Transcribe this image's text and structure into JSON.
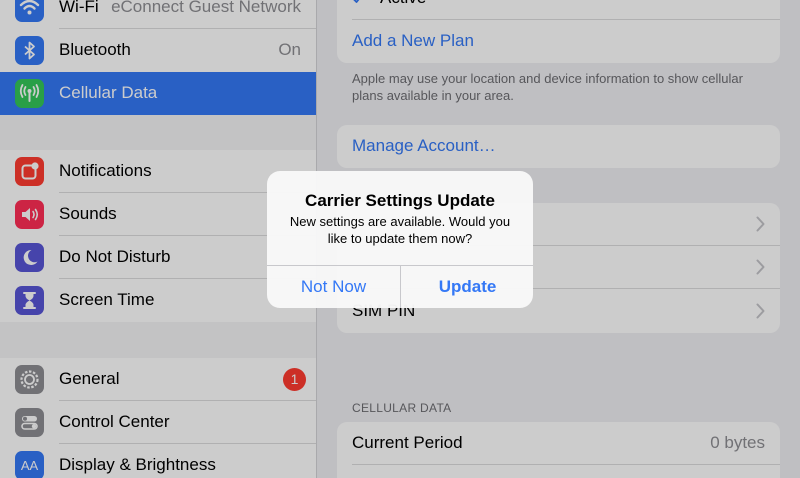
{
  "sidebar": {
    "wifi": {
      "label": "Wi-Fi",
      "value": "eConnect Guest Network",
      "icon": "wifi-icon",
      "color": "#3478f6"
    },
    "bluetooth": {
      "label": "Bluetooth",
      "value": "On",
      "icon": "bluetooth-icon",
      "color": "#3478f6"
    },
    "cellular": {
      "label": "Cellular Data",
      "icon": "antenna-icon",
      "color": "#34c759"
    },
    "notifications": {
      "label": "Notifications",
      "icon": "notifications-icon",
      "color": "#ff3b30"
    },
    "sounds": {
      "label": "Sounds",
      "icon": "speaker-icon",
      "color": "#ff2d55"
    },
    "dnd": {
      "label": "Do Not Disturb",
      "icon": "moon-icon",
      "color": "#5856d6"
    },
    "screentime": {
      "label": "Screen Time",
      "icon": "hourglass-icon",
      "color": "#5856d6"
    },
    "general": {
      "label": "General",
      "badge": "1",
      "icon": "gear-icon",
      "color": "#8e8e93"
    },
    "control": {
      "label": "Control Center",
      "icon": "switches-icon",
      "color": "#8e8e93"
    },
    "display": {
      "label": "Display & Brightness",
      "icon": "text-size-icon",
      "color": "#3478f6",
      "glyph": "AA"
    }
  },
  "main": {
    "plan_active": "Active",
    "add_plan": "Add a New Plan",
    "plans_note": "Apple may use your location and device information to show cellular plans available in your area.",
    "manage_account": "Manage Account…",
    "sim_pin": "SIM PIN",
    "section_header": "CELLULAR DATA",
    "current_period_label": "Current Period",
    "current_period_value": "0 bytes"
  },
  "alert": {
    "title": "Carrier Settings Update",
    "message": "New settings are available. Would you like to update them now?",
    "cancel": "Not Now",
    "confirm": "Update"
  }
}
